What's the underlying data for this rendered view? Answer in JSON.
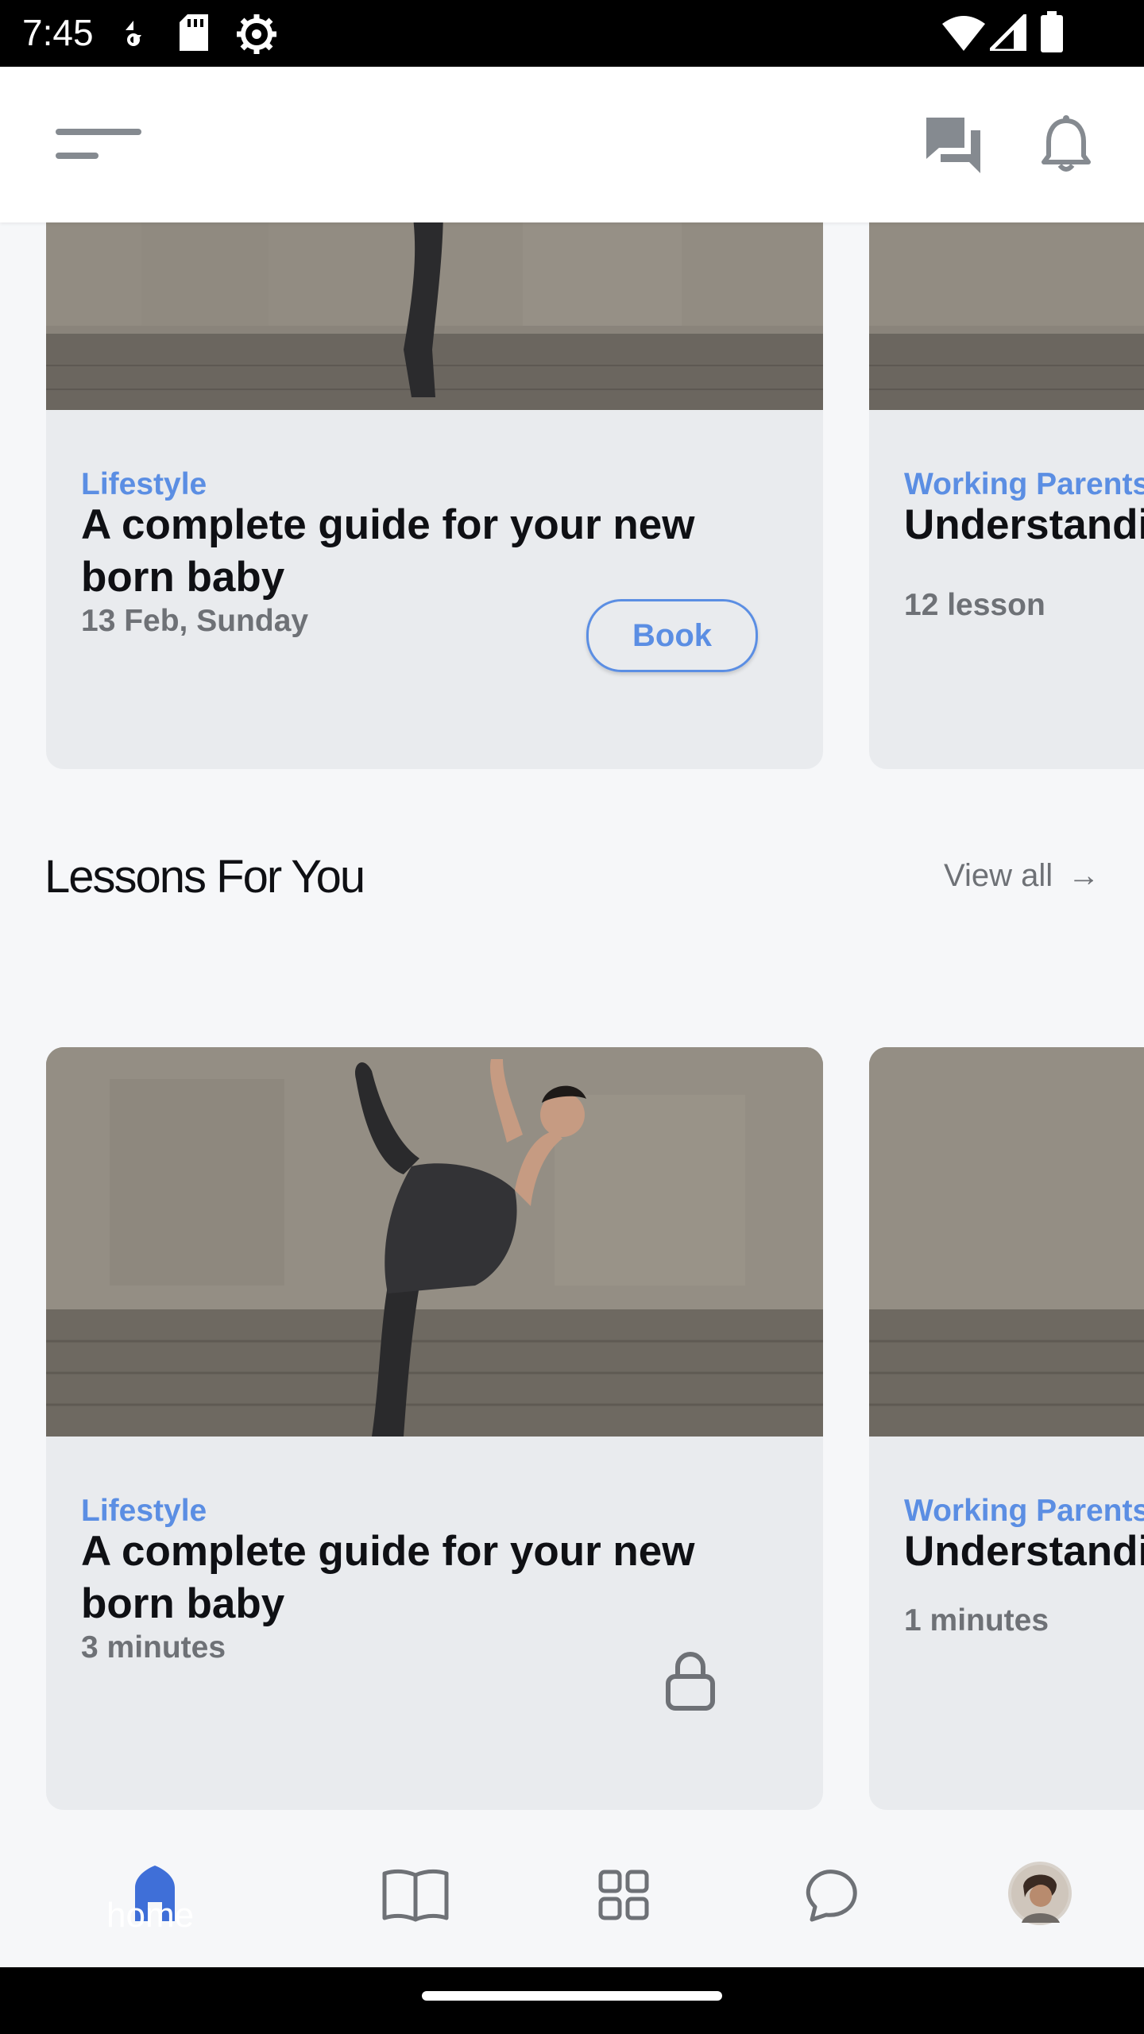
{
  "status_bar": {
    "time": "7:45"
  },
  "top_cards": [
    {
      "tag": "Lifestyle",
      "title": "A complete guide for your new born baby",
      "meta": "13 Feb, Sunday",
      "action": "Book"
    },
    {
      "tag": "Working Parents",
      "title": "Understandi",
      "meta": "12 lesson"
    }
  ],
  "section": {
    "title": "Lessons For You",
    "view_all": "View all",
    "view_all_arrow": "→"
  },
  "lesson_cards": [
    {
      "tag": "Lifestyle",
      "title": "A complete guide for your new born baby",
      "meta": "3 minutes"
    },
    {
      "tag": "Working Parents",
      "title": "Understandi",
      "meta": "1 minutes"
    }
  ],
  "bottom_nav": {
    "home_label": "home",
    "active_color": "#3f6fd8"
  },
  "colors": {
    "accent": "#5b8ee3",
    "card_bg": "#e9ebee",
    "page_bg": "#f6f7f9"
  }
}
